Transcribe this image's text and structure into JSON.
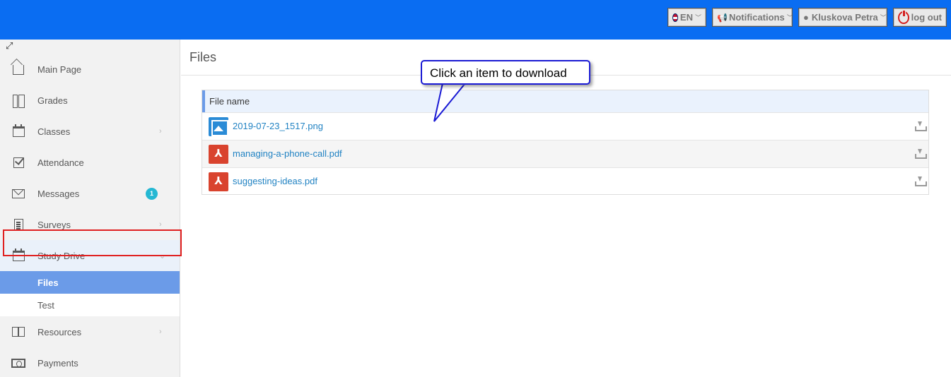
{
  "topbar": {
    "language": "EN",
    "notifications": "Notifications",
    "user": "Kluskova Petra",
    "logout": "log out"
  },
  "sidebar": {
    "items": [
      {
        "label": "Main Page"
      },
      {
        "label": "Grades"
      },
      {
        "label": "Classes"
      },
      {
        "label": "Attendance"
      },
      {
        "label": "Messages",
        "badge": "1"
      },
      {
        "label": "Surveys"
      },
      {
        "label": "Study Drive"
      },
      {
        "label": "Resources"
      },
      {
        "label": "Payments"
      }
    ],
    "subitems": [
      {
        "label": "Files"
      },
      {
        "label": "Test"
      }
    ]
  },
  "main": {
    "title": "Files",
    "table": {
      "header": "File name",
      "rows": [
        {
          "name": "2019-07-23_1517.png",
          "icon": "image-file-icon"
        },
        {
          "name": "managing-a-phone-call.pdf",
          "icon": "pdf-file-icon"
        },
        {
          "name": "suggesting-ideas.pdf",
          "icon": "pdf-file-icon"
        }
      ]
    }
  },
  "callout": {
    "text": "Click an item to download"
  },
  "colors": {
    "topbar": "#0a6df2",
    "active_subitem": "#6b9be8",
    "highlight_box": "#e02020",
    "callout_border": "#1a1ad4",
    "link": "#2283c3",
    "badge": "#25b8d3"
  }
}
